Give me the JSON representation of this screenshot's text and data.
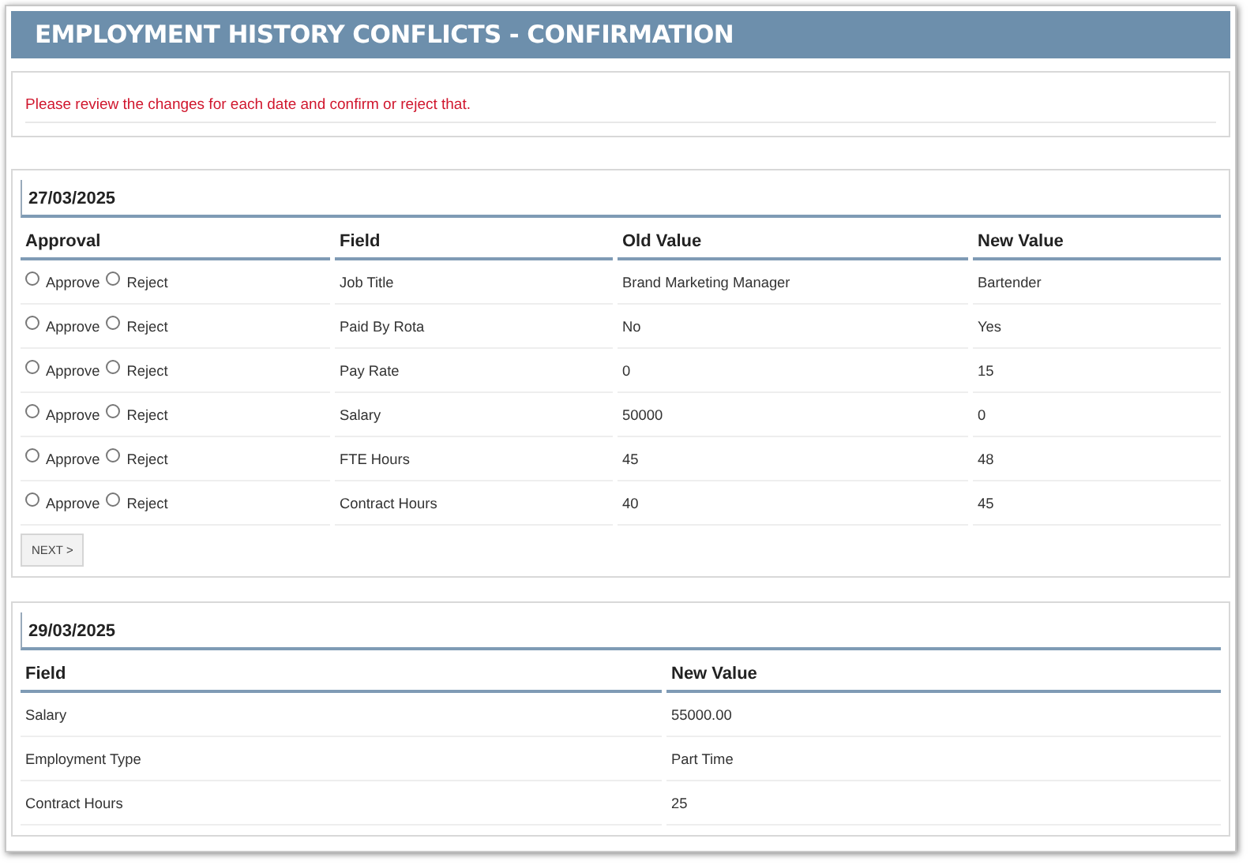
{
  "title": "EMPLOYMENT HISTORY CONFLICTS - CONFIRMATION",
  "notice": "Please review the changes for each date and confirm or reject that.",
  "sections": [
    {
      "date": "27/03/2025",
      "kind": "approval",
      "columns": [
        "Approval",
        "Field",
        "Old Value",
        "New Value"
      ],
      "rows": [
        {
          "options": [
            {
              "label": "Approve",
              "selected": false
            },
            {
              "label": "Reject",
              "selected": false
            }
          ],
          "field": "Job Title",
          "old_value": "Brand Marketing Manager",
          "new_value": "Bartender"
        },
        {
          "options": [
            {
              "label": "Approve",
              "selected": false
            },
            {
              "label": "Reject",
              "selected": false
            }
          ],
          "field": "Paid By Rota",
          "old_value": "No",
          "new_value": "Yes"
        },
        {
          "options": [
            {
              "label": "Approve",
              "selected": false
            },
            {
              "label": "Reject",
              "selected": false
            }
          ],
          "field": "Pay Rate",
          "old_value": "0",
          "new_value": "15"
        },
        {
          "options": [
            {
              "label": "Approve",
              "selected": false
            },
            {
              "label": "Reject",
              "selected": false
            }
          ],
          "field": "Salary",
          "old_value": "50000",
          "new_value": "0"
        },
        {
          "options": [
            {
              "label": "Approve",
              "selected": false
            },
            {
              "label": "Reject",
              "selected": false
            }
          ],
          "field": "FTE Hours",
          "old_value": "45",
          "new_value": "48"
        },
        {
          "options": [
            {
              "label": "Approve",
              "selected": false
            },
            {
              "label": "Reject",
              "selected": false
            }
          ],
          "field": "Contract Hours",
          "old_value": "40",
          "new_value": "45"
        }
      ],
      "button": "NEXT >"
    },
    {
      "date": "29/03/2025",
      "kind": "info",
      "columns": [
        "Field",
        "New Value"
      ],
      "rows": [
        {
          "field": "Salary",
          "new_value": "55000.00"
        },
        {
          "field": "Employment Type",
          "new_value": "Part Time"
        },
        {
          "field": "Contract Hours",
          "new_value": "25"
        }
      ]
    }
  ]
}
